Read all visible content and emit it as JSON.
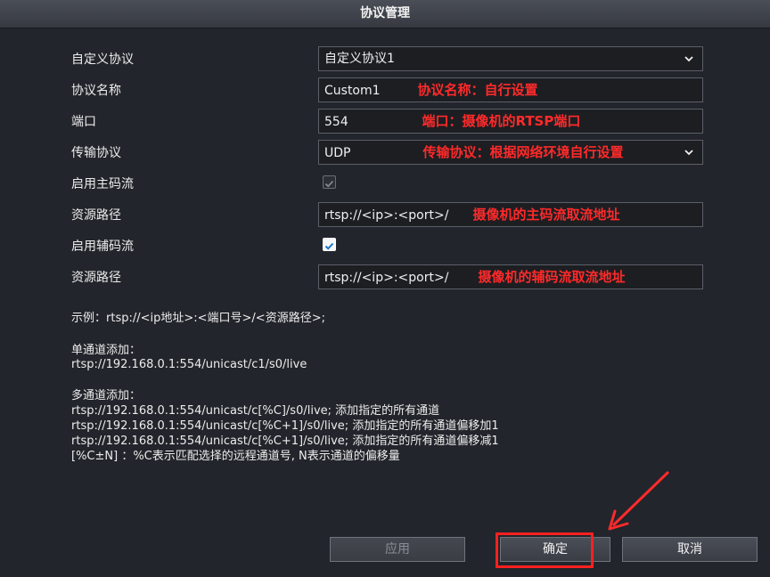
{
  "window": {
    "title": "协议管理"
  },
  "form": {
    "custom_protocol": {
      "label": "自定义协议",
      "value": "自定义协议1"
    },
    "protocol_name": {
      "label": "协议名称",
      "value": "Custom1",
      "note": "协议名称：自行设置"
    },
    "port": {
      "label": "端口",
      "value": "554",
      "note": "端口：摄像机的RTSP端口"
    },
    "transport": {
      "label": "传输协议",
      "value": "UDP",
      "note": "传输协议：根据网络环境自行设置"
    },
    "main_stream": {
      "label": "启用主码流",
      "checked": true,
      "disabled": true
    },
    "main_path": {
      "label": "资源路径",
      "value": "rtsp://<ip>:<port>/",
      "note": "摄像机的主码流取流地址"
    },
    "sub_stream": {
      "label": "启用辅码流",
      "checked": true,
      "disabled": false
    },
    "sub_path": {
      "label": "资源路径",
      "value": "rtsp://<ip>:<port>/",
      "note": "摄像机的辅码流取流地址"
    }
  },
  "help": {
    "example": "示例：rtsp://<ip地址>:<端口号>/<资源路径>;",
    "single_title": "单通道添加：",
    "single_line": "rtsp://192.168.0.1:554/unicast/c1/s0/live",
    "multi_title": "多通道添加：",
    "multi_lines": [
      "rtsp://192.168.0.1:554/unicast/c[%C]/s0/live; 添加指定的所有通道",
      "rtsp://192.168.0.1:554/unicast/c[%C+1]/s0/live; 添加指定的所有通道偏移加1",
      "rtsp://192.168.0.1:554/unicast/c[%C+1]/s0/live; 添加指定的所有通道偏移减1",
      "[%C±N] ：%C表示匹配选择的远程通道号, N表示通道的偏移量"
    ]
  },
  "buttons": {
    "apply": "应用",
    "ok": "确定",
    "cancel": "取消"
  },
  "colors": {
    "annotation": "#ff2a2a",
    "background": "#22252b"
  }
}
